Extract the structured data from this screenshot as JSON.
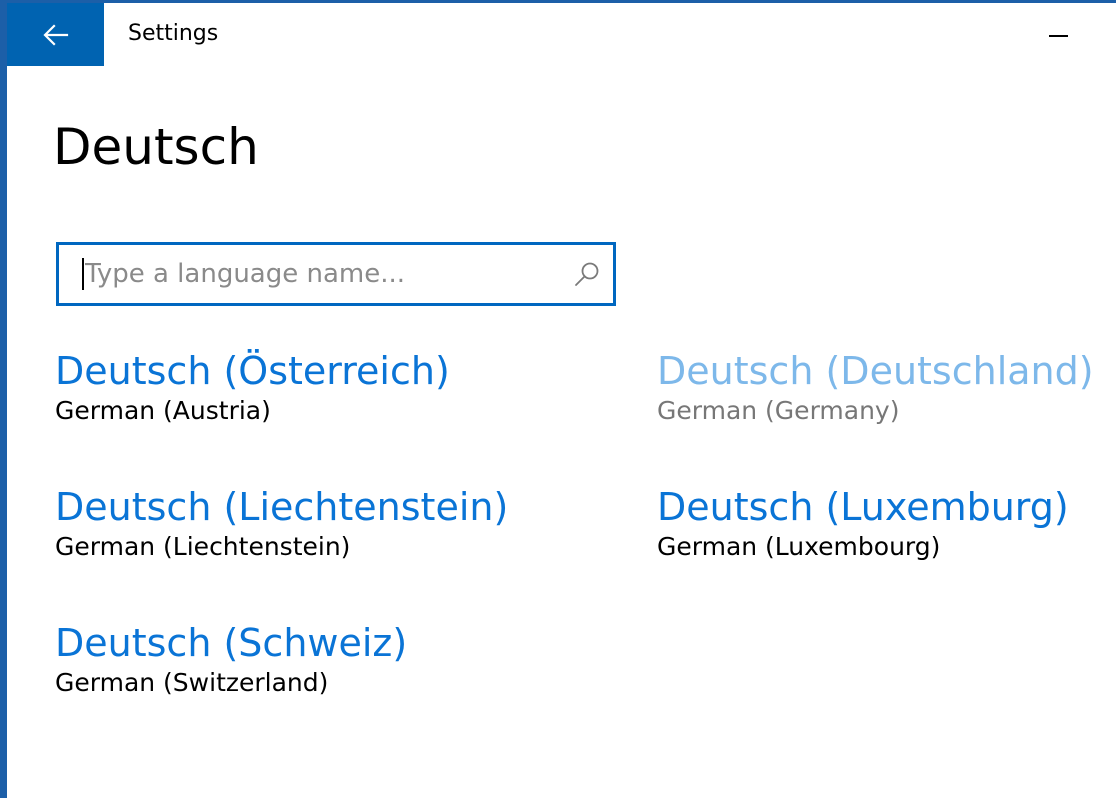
{
  "window": {
    "title": "Settings",
    "accent_color": "#0063b1"
  },
  "page": {
    "title": "Deutsch"
  },
  "search": {
    "value": "",
    "placeholder": "Type a language name..."
  },
  "languages": [
    {
      "name": "Deutsch (Österreich)",
      "english": "German (Austria)",
      "state": "enabled"
    },
    {
      "name": "Deutsch (Deutschland)",
      "english": "German (Germany)",
      "state": "disabled"
    },
    {
      "name": "Deutsch (Liechtenstein)",
      "english": "German (Liechtenstein)",
      "state": "enabled"
    },
    {
      "name": "Deutsch (Luxemburg)",
      "english": "German (Luxembourg)",
      "state": "enabled"
    },
    {
      "name": "Deutsch (Schweiz)",
      "english": "German (Switzerland)",
      "state": "enabled"
    }
  ],
  "icons": {
    "back": "back-arrow-icon",
    "search": "search-icon",
    "minimize": "minimize-icon"
  },
  "colors": {
    "link": "#0a74d6",
    "link_disabled": "#7db8ea",
    "focus_border": "#0067c0"
  }
}
